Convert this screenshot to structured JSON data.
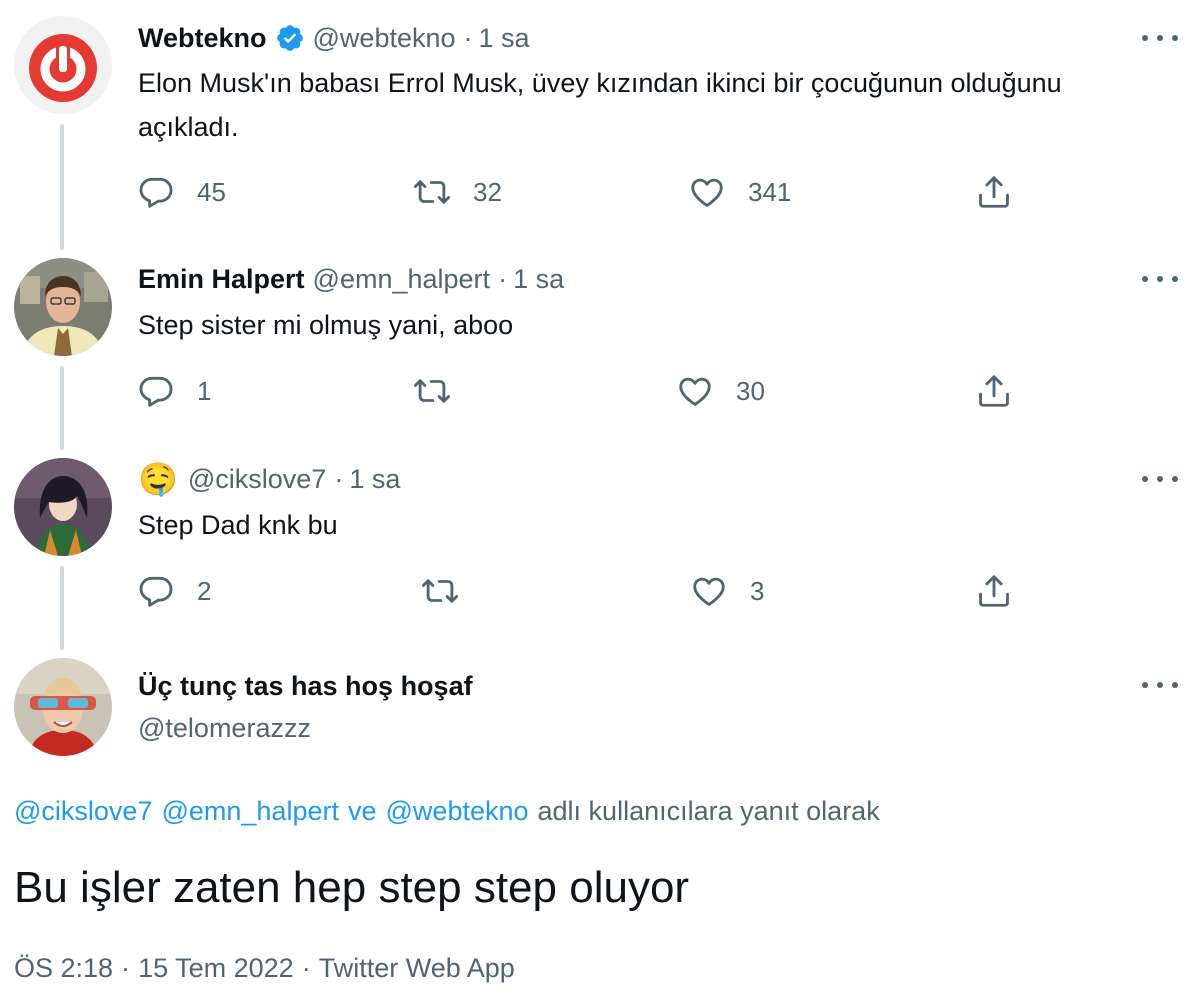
{
  "thread": [
    {
      "display_name": "Webtekno",
      "verified": true,
      "handle": "@webtekno",
      "dot": "·",
      "time": "1 sa",
      "text": "Elon Musk'ın babası Errol Musk, üvey kızından ikinci bir çocuğunun olduğunu açıkladı.",
      "replies": "45",
      "retweets": "32",
      "likes": "341"
    },
    {
      "display_name": "Emin Halpert",
      "verified": false,
      "handle": "@emn_halpert",
      "dot": "·",
      "time": "1 sa",
      "text": "Step sister mi olmuş yani, aboo",
      "replies": "1",
      "retweets": "",
      "likes": "30"
    },
    {
      "display_name": "🤤",
      "verified": false,
      "handle": "@cikslove7",
      "dot": "·",
      "time": "1 sa",
      "text": "Step Dad knk bu",
      "replies": "2",
      "retweets": "",
      "likes": "3"
    }
  ],
  "main_tweet": {
    "display_name": "Üç tunç tas has hoş hoşaf",
    "handle": "@telomerazzz",
    "reply_mentions": [
      "@cikslove7",
      "@emn_halpert",
      "ve",
      "@webtekno"
    ],
    "reply_suffix": "adlı kullanıcılara yanıt olarak",
    "text": "Bu işler zaten hep step step oluyor",
    "time": "ÖS 2:18",
    "dot": "·",
    "date": "15 Tem 2022",
    "source": "Twitter Web App"
  },
  "colors": {
    "link": "#1d9bf0",
    "secondary_text": "#536471",
    "thread_line": "#cfd9de",
    "verified": "#1d9bf0"
  },
  "icons": [
    "reply-icon",
    "retweet-icon",
    "like-icon",
    "share-icon",
    "more-icon",
    "verified-badge-icon"
  ]
}
